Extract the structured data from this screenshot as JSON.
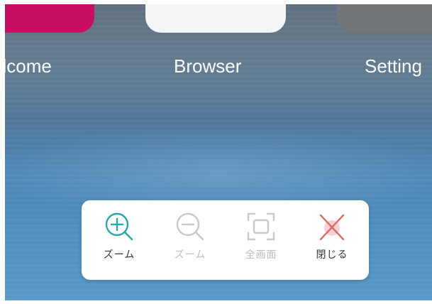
{
  "apps": [
    {
      "label": "elcome",
      "color": "#c70e63"
    },
    {
      "label": "Browser",
      "color": "#f4f5f6"
    },
    {
      "label": "Setting",
      "color": "#737679"
    }
  ],
  "toolbar": {
    "zoom_in": {
      "label": "ズーム",
      "icon": "zoom-in-icon",
      "enabled": true,
      "color": "#2aa8a8"
    },
    "zoom_out": {
      "label": "ズーム",
      "icon": "zoom-out-icon",
      "enabled": false,
      "color": "#c8c8c8"
    },
    "fit_screen": {
      "label": "全画面",
      "icon": "fullscreen-icon",
      "enabled": false,
      "color": "#c8c8c8"
    },
    "close": {
      "label": "閉じる",
      "icon": "close-icon",
      "enabled": true,
      "color": "#e06a6a"
    }
  }
}
